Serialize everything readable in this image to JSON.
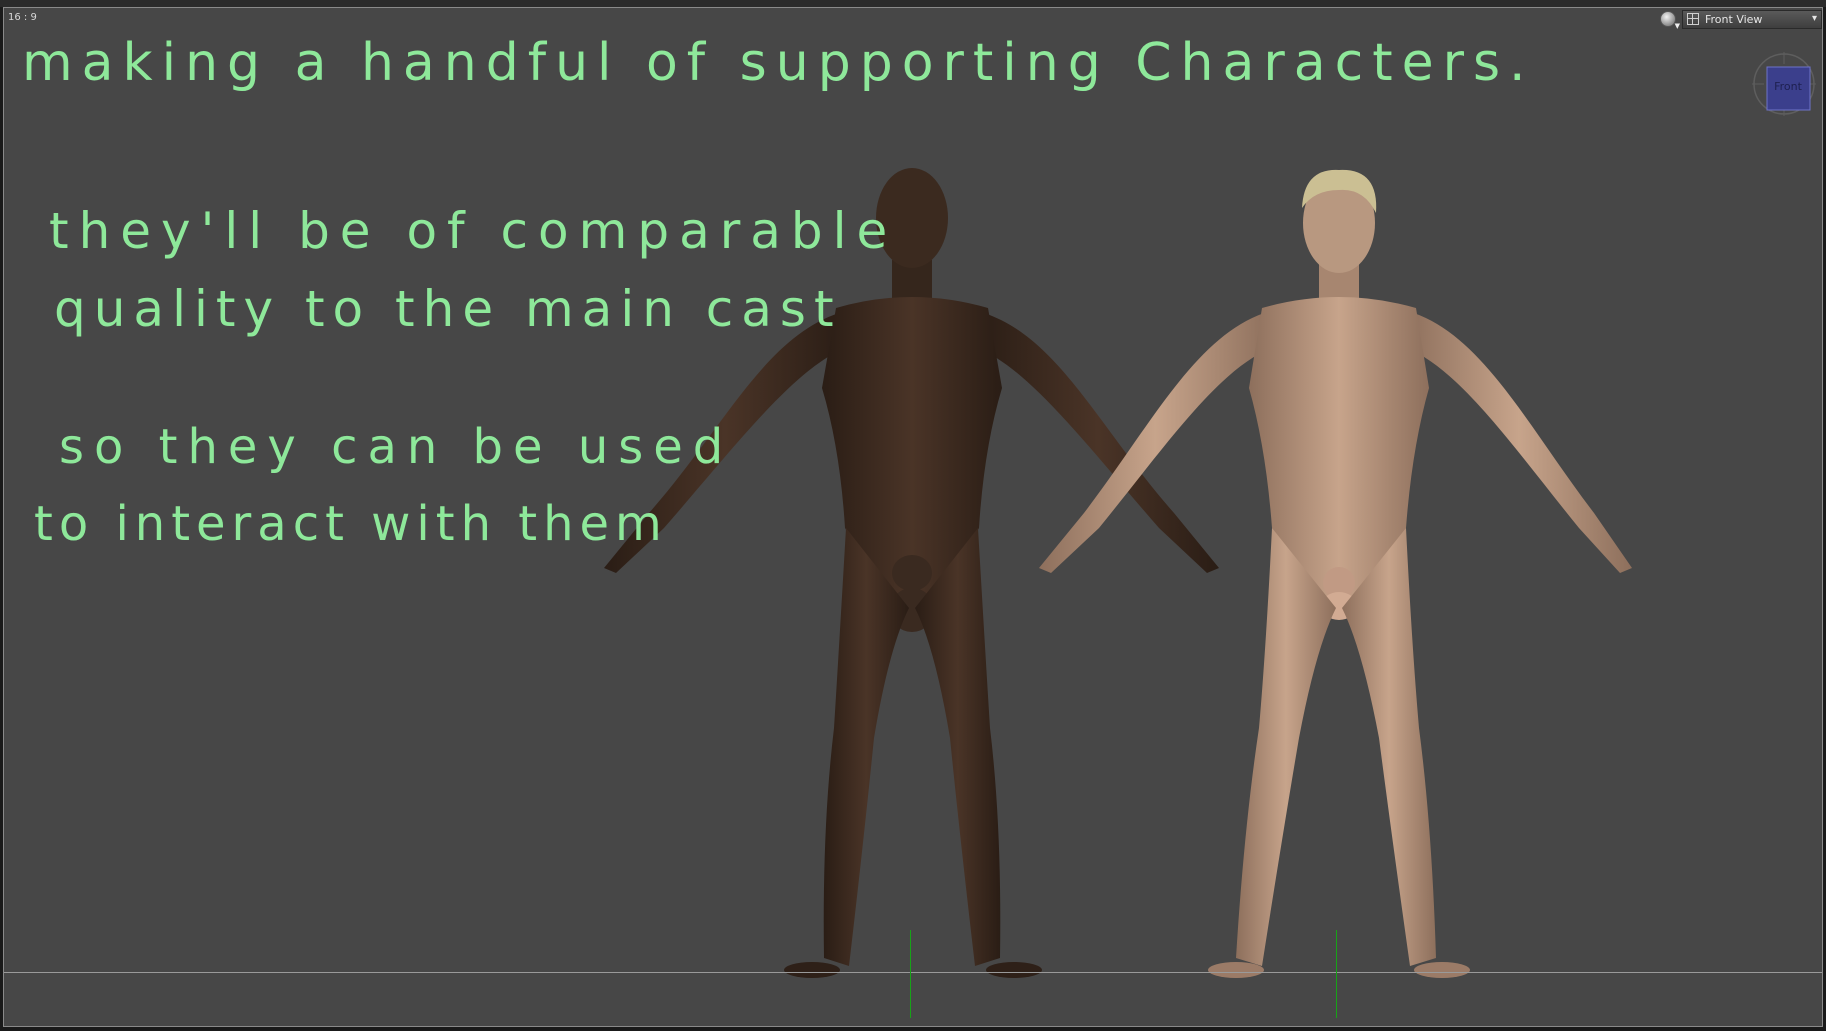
{
  "viewport": {
    "aspect_label": "16 : 9",
    "view_select_label": "Front View",
    "view_cube_label": "Front"
  },
  "annotation": {
    "line1": "making a handful of supporting Characters.",
    "line2": "they'll be of comparable",
    "line3": "quality to the main cast",
    "line4": "so they can be used",
    "line5": "to interact with them"
  },
  "colors": {
    "annotation": "#8ee89a",
    "viewport_bg": "#474747",
    "axis": "#17a317"
  },
  "icons": {
    "camera": "camera-sphere-icon",
    "view": "view-grid-icon",
    "caret": "chevron-down-icon"
  }
}
